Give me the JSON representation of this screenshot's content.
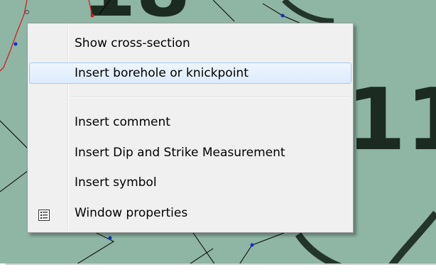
{
  "map": {
    "background": "#8fb5a4",
    "fragments": [
      "18",
      "11"
    ]
  },
  "context_menu": {
    "items": [
      {
        "label": "Show cross-section"
      },
      {
        "label": "Insert borehole or knickpoint"
      },
      {
        "label": "Insert comment"
      },
      {
        "label": "Insert Dip and Strike Measurement"
      },
      {
        "label": "Insert symbol"
      },
      {
        "label": "Window properties",
        "icon": "properties-list-icon"
      }
    ],
    "hover_color": "#dcebfc",
    "hover_border": "#a8c9ee"
  }
}
